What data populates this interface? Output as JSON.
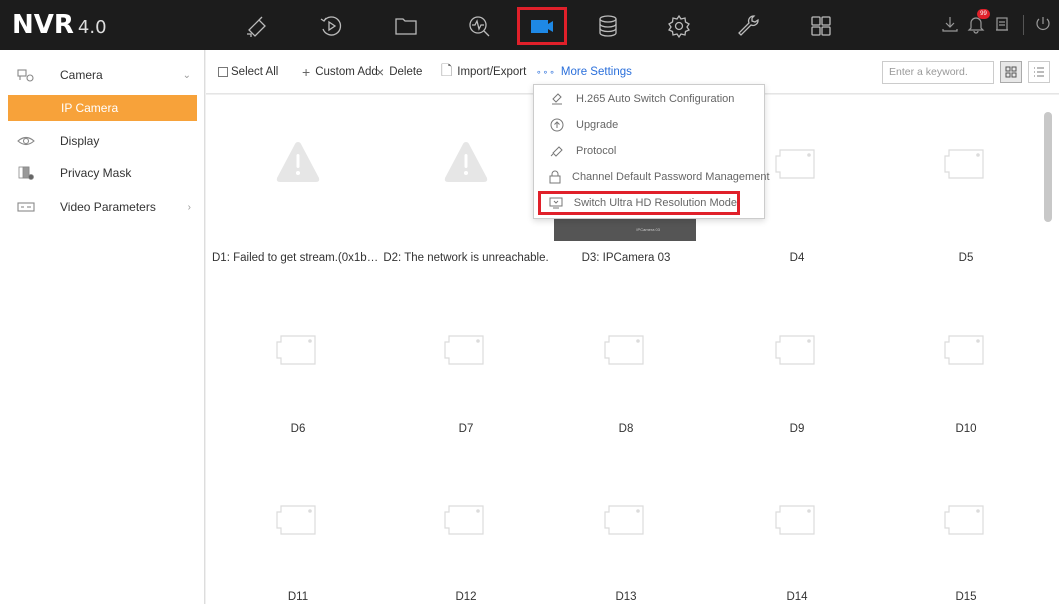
{
  "app": {
    "logo": "NVR",
    "version": "4.0"
  },
  "topbar": {
    "nav": [
      {
        "name": "live-view-icon"
      },
      {
        "name": "playback-icon"
      },
      {
        "name": "file-management-icon"
      },
      {
        "name": "smart-analysis-icon"
      },
      {
        "name": "configuration-icon",
        "active": true
      },
      {
        "name": "storage-icon"
      },
      {
        "name": "system-settings-icon"
      },
      {
        "name": "maintenance-icon"
      },
      {
        "name": "extended-apps-icon"
      }
    ],
    "notification_badge": "99",
    "right_icons": [
      "download-icon",
      "bell-icon",
      "lock-icon",
      "power-icon"
    ]
  },
  "sidebar": {
    "items": [
      {
        "label": "Camera",
        "icon": "camera-icon",
        "expanded": true
      },
      {
        "label": "Display",
        "icon": "eye-icon"
      },
      {
        "label": "Privacy Mask",
        "icon": "privacy-mask-icon"
      },
      {
        "label": "Video Parameters",
        "icon": "video-parameters-icon"
      }
    ],
    "sub_item": "IP Camera"
  },
  "toolbar": {
    "select_all": "Select All",
    "custom_add": "Custom Add",
    "delete": "Delete",
    "import_export": "Import/Export",
    "more_settings": "More Settings",
    "search_placeholder": "Enter a keyword."
  },
  "dropdown": {
    "items": [
      {
        "label": "H.265 Auto Switch Configuration",
        "icon": "h265-icon"
      },
      {
        "label": "Upgrade",
        "icon": "upgrade-icon"
      },
      {
        "label": "Protocol",
        "icon": "protocol-icon"
      },
      {
        "label": "Channel Default Password Management",
        "icon": "lock-icon"
      },
      {
        "label": "Switch Ultra HD Resolution Mode",
        "icon": "monitor-icon",
        "highlighted": true
      }
    ]
  },
  "cameras": [
    {
      "label": "D1: Failed to get stream.(0x1b01...",
      "status": "error"
    },
    {
      "label": "D2: The network is unreachable.",
      "status": "error"
    },
    {
      "label": "D3: IPCamera 03",
      "status": "online"
    },
    {
      "label": "D4",
      "status": "empty"
    },
    {
      "label": "D5",
      "status": "empty"
    },
    {
      "label": "D6",
      "status": "empty"
    },
    {
      "label": "D7",
      "status": "empty"
    },
    {
      "label": "D8",
      "status": "empty"
    },
    {
      "label": "D9",
      "status": "empty"
    },
    {
      "label": "D10",
      "status": "empty"
    },
    {
      "label": "D11",
      "status": "empty"
    },
    {
      "label": "D12",
      "status": "empty"
    },
    {
      "label": "D13",
      "status": "empty"
    },
    {
      "label": "D14",
      "status": "empty"
    },
    {
      "label": "D15",
      "status": "empty"
    }
  ],
  "colors": {
    "accent": "#f7a23a",
    "highlight": "#e0202a",
    "link": "#2a6fdb",
    "topbar": "#1c1c1c"
  }
}
